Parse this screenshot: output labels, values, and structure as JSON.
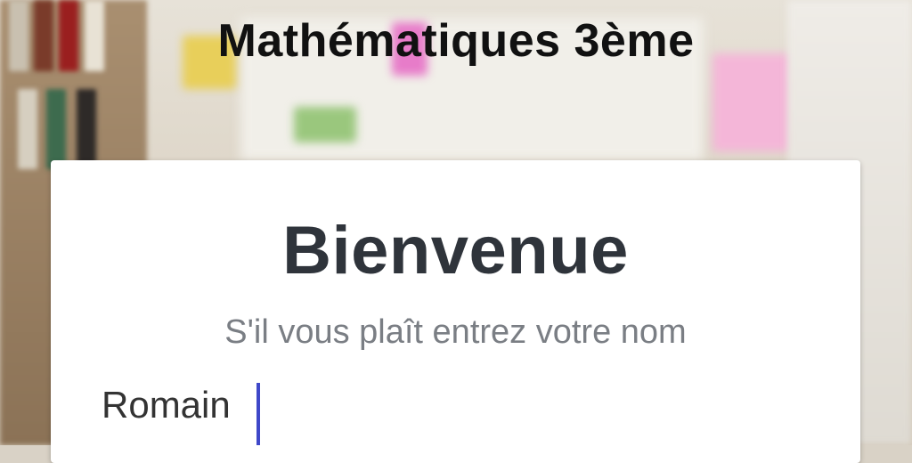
{
  "header": {
    "title": "Mathématiques 3ème"
  },
  "welcome_card": {
    "heading": "Bienvenue",
    "prompt": "S'il vous plaît entrez votre nom",
    "name_input": {
      "value": "Romain"
    }
  },
  "colors": {
    "heading": "#2f343b",
    "prompt": "#7a7e84",
    "caret": "#3f48c9"
  }
}
